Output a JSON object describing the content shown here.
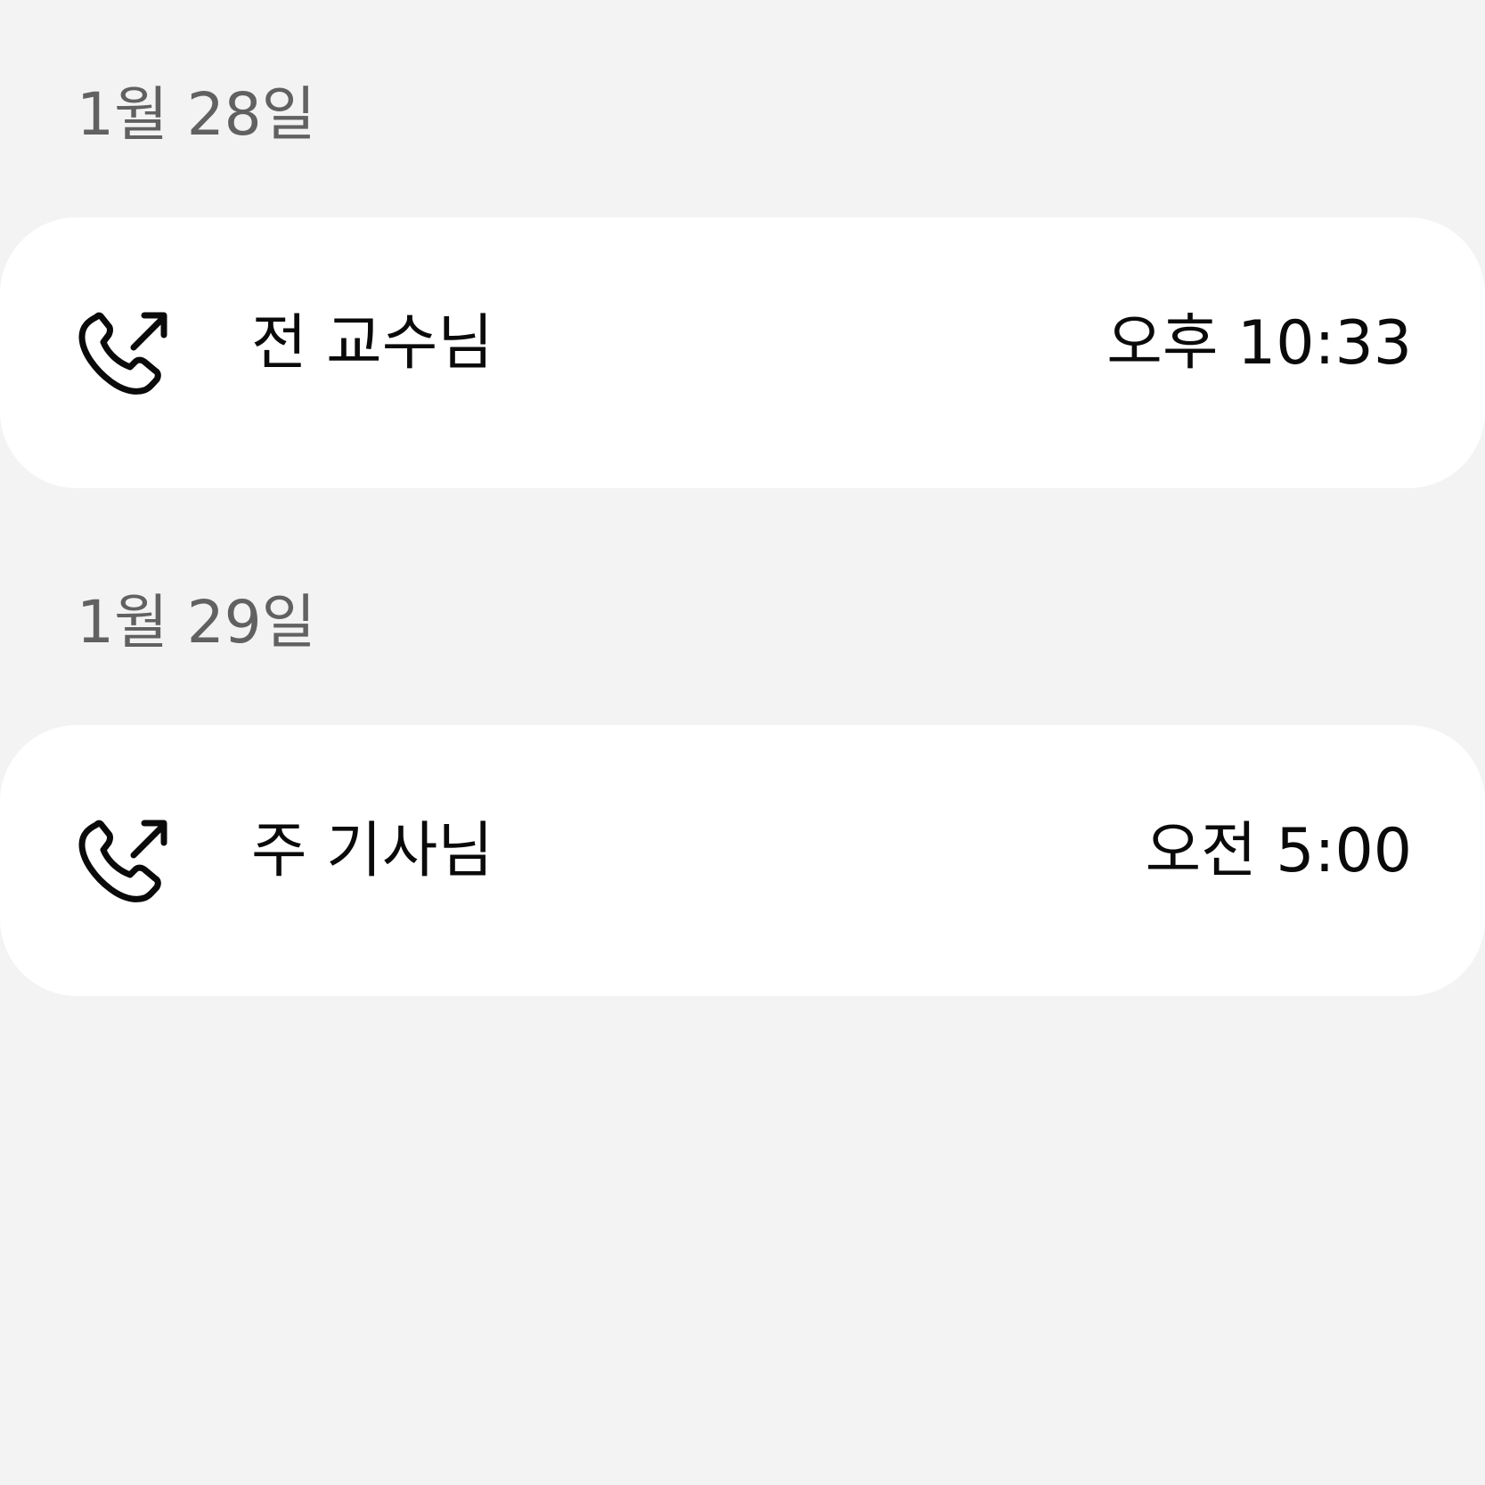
{
  "call_log": {
    "groups": [
      {
        "date": "1월 28일",
        "calls": [
          {
            "name": "전 교수님",
            "time": "오후 10:33",
            "icon": "outgoing-call-icon"
          }
        ]
      },
      {
        "date": "1월 29일",
        "calls": [
          {
            "name": "주 기사님",
            "time": "오전 5:00",
            "icon": "outgoing-call-icon"
          }
        ]
      }
    ]
  },
  "colors": {
    "background": "#f3f3f3",
    "card": "#ffffff",
    "date_text": "#616161",
    "primary_text": "#0a0a0a"
  }
}
